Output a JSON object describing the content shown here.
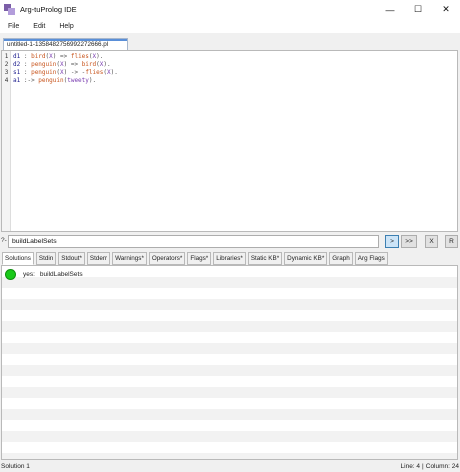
{
  "window": {
    "title": "Arg-tuProlog IDE",
    "controls": {
      "minimize": "—",
      "maximize": "☐",
      "close": "✕"
    }
  },
  "menu": {
    "items": [
      "File",
      "Edit",
      "Help"
    ]
  },
  "editor": {
    "tab_label": "untitled-1-1358482756992272666.pl",
    "lines": [
      {
        "num": "1",
        "label": "d1",
        "body": [
          [
            "c-op",
            " : "
          ],
          [
            "c-pred",
            "bird"
          ],
          [
            "c-op",
            "("
          ],
          [
            "c-var",
            "X"
          ],
          [
            "c-op",
            ") => "
          ],
          [
            "c-pred",
            "flies"
          ],
          [
            "c-op",
            "("
          ],
          [
            "c-var",
            "X"
          ],
          [
            "c-op",
            ")."
          ]
        ]
      },
      {
        "num": "2",
        "label": "d2",
        "body": [
          [
            "c-op",
            " : "
          ],
          [
            "c-pred",
            "penguin"
          ],
          [
            "c-op",
            "("
          ],
          [
            "c-var",
            "X"
          ],
          [
            "c-op",
            ") => "
          ],
          [
            "c-pred",
            "bird"
          ],
          [
            "c-op",
            "("
          ],
          [
            "c-var",
            "X"
          ],
          [
            "c-op",
            ")."
          ]
        ]
      },
      {
        "num": "3",
        "label": "s1",
        "body": [
          [
            "c-op",
            " : "
          ],
          [
            "c-pred",
            "penguin"
          ],
          [
            "c-op",
            "("
          ],
          [
            "c-var",
            "X"
          ],
          [
            "c-op",
            ") -> -"
          ],
          [
            "c-pred",
            "flies"
          ],
          [
            "c-op",
            "("
          ],
          [
            "c-var",
            "X"
          ],
          [
            "c-op",
            ")."
          ]
        ]
      },
      {
        "num": "4",
        "label": "a1",
        "body": [
          [
            "c-op",
            " :-> "
          ],
          [
            "c-pred",
            "penguin"
          ],
          [
            "c-op",
            "("
          ],
          [
            "c-var",
            "tweety"
          ],
          [
            "c-op",
            ")."
          ]
        ]
      }
    ]
  },
  "query": {
    "prompt": "?-",
    "value": "buildLabelSets",
    "buttons": {
      "run": ">",
      "next": ">>",
      "stop": "X",
      "reset": "R"
    }
  },
  "result_tabs": [
    "Solutions",
    "Stdin",
    "Stdout*",
    "Stderr",
    "Warnings*",
    "Operators*",
    "Flags*",
    "Libraries*",
    "Static KB*",
    "Dynamic KB*",
    "Graph",
    "Arg Flags"
  ],
  "active_result_tab": 0,
  "solution": {
    "status": "yes:",
    "value": "buildLabelSets"
  },
  "status_bar": {
    "left": "Solution 1",
    "line": "Line: 4",
    "sep": "|",
    "column": "Column: 24"
  }
}
